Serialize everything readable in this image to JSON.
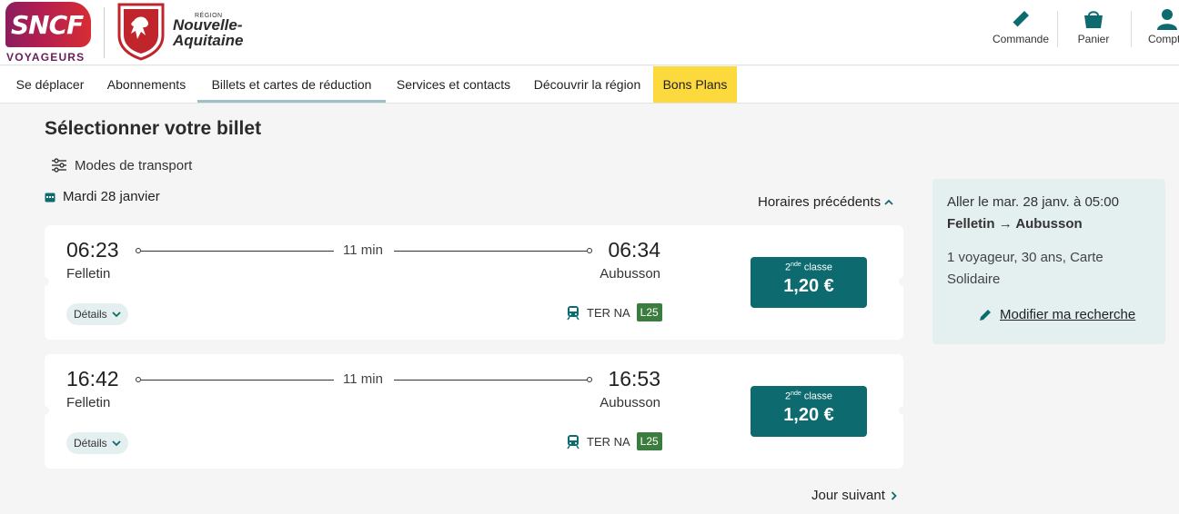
{
  "header": {
    "brand_text": "SNCF",
    "brand_sub": "VOYAGEURS",
    "region_small": "RÉGION",
    "region_name_line1": "Nouvelle-",
    "region_name_line2": "Aquitaine",
    "actions": [
      {
        "label": "Commande",
        "icon": "ticket-icon"
      },
      {
        "label": "Panier",
        "icon": "basket-icon"
      },
      {
        "label": "Compte",
        "icon": "user-icon"
      }
    ]
  },
  "nav": {
    "items": [
      {
        "label": "Se déplacer"
      },
      {
        "label": "Abonnements"
      },
      {
        "label": "Billets et cartes de réduction"
      },
      {
        "label": "Services et contacts"
      },
      {
        "label": "Découvrir la région"
      },
      {
        "label": "Bons Plans"
      }
    ],
    "active_index": 2,
    "highlight_color": "#fcd93d"
  },
  "main": {
    "title": "Sélectionner votre billet",
    "modes_label": "Modes de transport",
    "date": "Mardi 28 janvier",
    "prev_label": "Horaires précédents",
    "next_label": "Jour suivant"
  },
  "journeys": [
    {
      "dep_time": "06:23",
      "dep_station": "Felletin",
      "arr_time": "06:34",
      "arr_station": "Aubusson",
      "duration": "11 min",
      "details_label": "Détails",
      "mode": "TER NA",
      "line": "L25",
      "class_num": "2",
      "class_sup": "nde",
      "class_word": "classe",
      "price": "1,20 €"
    },
    {
      "dep_time": "16:42",
      "dep_station": "Felletin",
      "arr_time": "16:53",
      "arr_station": "Aubusson",
      "duration": "11 min",
      "details_label": "Détails",
      "mode": "TER NA",
      "line": "L25",
      "class_num": "2",
      "class_sup": "nde",
      "class_word": "classe",
      "price": "1,20 €"
    }
  ],
  "summary": {
    "outbound": "Aller le mar. 28 janv. à 05:00",
    "route_from": "Felletin",
    "route_arrow": "→",
    "route_to": "Aubusson",
    "passengers": "1 voyageur, 30 ans, Carte Solidaire",
    "modify_label": "Modifier ma recherche"
  },
  "colors": {
    "primary": "#0d6b70",
    "summary_bg": "#e4eff0",
    "line_badge": "#3b7d3e",
    "brand_gradient_start": "#8c1d5f",
    "brand_gradient_end": "#d72d33"
  }
}
